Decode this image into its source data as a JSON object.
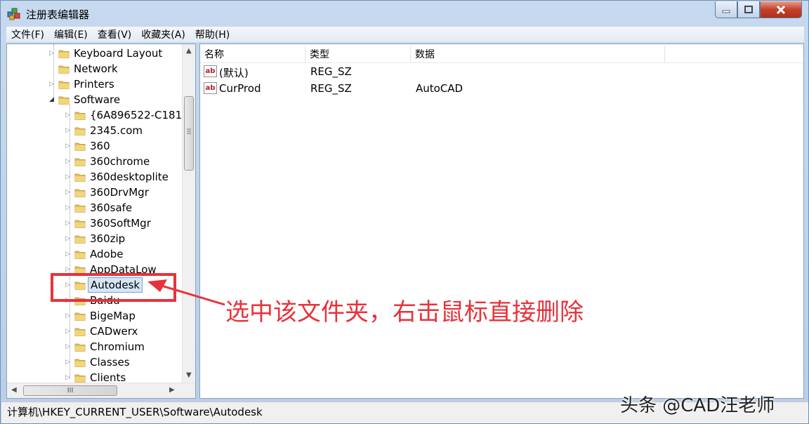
{
  "window": {
    "title": "注册表编辑器"
  },
  "menu": [
    "文件(F)",
    "编辑(E)",
    "查看(V)",
    "收藏夹(A)",
    "帮助(H)"
  ],
  "tree": {
    "items": [
      {
        "label": "Keyboard Layout",
        "level": 1,
        "expander": "collapsed"
      },
      {
        "label": "Network",
        "level": 1,
        "expander": "none"
      },
      {
        "label": "Printers",
        "level": 1,
        "expander": "collapsed"
      },
      {
        "label": "Software",
        "level": 1,
        "expander": "expanded"
      },
      {
        "label": "{6A896522-C181-",
        "level": 2,
        "expander": "collapsed"
      },
      {
        "label": "2345.com",
        "level": 2,
        "expander": "collapsed"
      },
      {
        "label": "360",
        "level": 2,
        "expander": "collapsed"
      },
      {
        "label": "360chrome",
        "level": 2,
        "expander": "collapsed"
      },
      {
        "label": "360desktoplite",
        "level": 2,
        "expander": "collapsed"
      },
      {
        "label": "360DrvMgr",
        "level": 2,
        "expander": "collapsed"
      },
      {
        "label": "360safe",
        "level": 2,
        "expander": "collapsed"
      },
      {
        "label": "360SoftMgr",
        "level": 2,
        "expander": "collapsed"
      },
      {
        "label": "360zip",
        "level": 2,
        "expander": "collapsed"
      },
      {
        "label": "Adobe",
        "level": 2,
        "expander": "collapsed"
      },
      {
        "label": "AppDataLow",
        "level": 2,
        "expander": "collapsed"
      },
      {
        "label": "Autodesk",
        "level": 2,
        "expander": "collapsed",
        "selected": true
      },
      {
        "label": "Baidu",
        "level": 2,
        "expander": "collapsed"
      },
      {
        "label": "BigeMap",
        "level": 2,
        "expander": "collapsed"
      },
      {
        "label": "CADwerx",
        "level": 2,
        "expander": "collapsed"
      },
      {
        "label": "Chromium",
        "level": 2,
        "expander": "collapsed"
      },
      {
        "label": "Classes",
        "level": 2,
        "expander": "collapsed"
      },
      {
        "label": "Clients",
        "level": 2,
        "expander": "collapsed"
      }
    ],
    "hscroll_thumb_glyph": "III"
  },
  "list": {
    "columns": [
      "名称",
      "类型",
      "数据"
    ],
    "rows": [
      {
        "name": "(默认)",
        "type": "REG_SZ",
        "data": "",
        "icon": "ab-string-icon",
        "icon_text": "ab"
      },
      {
        "name": "CurProd",
        "type": "REG_SZ",
        "data": "AutoCAD",
        "icon": "ab-string-icon",
        "icon_text": "ab"
      }
    ]
  },
  "status": {
    "path": "计算机\\HKEY_CURRENT_USER\\Software\\Autodesk"
  },
  "annotation": {
    "text": "选中该文件夹，右击鼠标直接删除",
    "color": "#e8323a"
  },
  "watermark": {
    "text": "头条 @CAD汪老师"
  }
}
